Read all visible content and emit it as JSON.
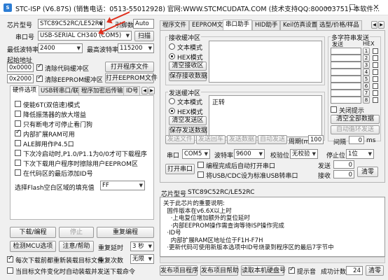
{
  "window": {
    "title": "STC-ISP (V6.87S) (销售电话：0513-55012928) 官网:WWW.STCMCUDATA.COM  (技术支持QQ:800003751) 本软件...",
    "min_icon": "minimize-icon",
    "max_icon": "maximize-icon",
    "close_icon": "close-icon",
    "min": "—",
    "max": "☐",
    "close": "✕"
  },
  "left": {
    "chip_label": "芯片型号",
    "chip_value": "STC89C52RC/LE52RC",
    "pin_label": "引脚数",
    "pin_value": "Auto",
    "port_label": "串口号",
    "port_value": "USB-SERIAL CH340 (COM5)",
    "scan_button": "扫描",
    "min_baud_label": "最低波特率",
    "min_baud_value": "2400",
    "max_baud_label": "最高波特率",
    "max_baud_value": "115200",
    "start_addr_label": "起始地址",
    "addr1": "0x0000",
    "clear_code_label": "清除代码缓冲区",
    "open_prog_button": "打开程序文件",
    "addr2": "0x2000",
    "clear_eeprom_label": "清除EEPROM缓冲区",
    "open_eeprom_button": "打开EEPROM文件",
    "tabs": [
      "硬件选项",
      "USB转串口/联机",
      "程序加密后传输",
      "ID号"
    ],
    "tab_nav": [
      "◀",
      "▶"
    ],
    "options": [
      {
        "label": "使能6T(双倍速)模式",
        "checked": false
      },
      {
        "label": "降低振荡器的放大增益",
        "checked": false
      },
      {
        "label": "只有断电才可停止看门狗",
        "checked": false
      },
      {
        "label": "内部扩展RAM可用",
        "checked": true
      },
      {
        "label": "ALE脚用作P4.5口",
        "checked": false
      },
      {
        "label": "下次冷启动时,P1.0/P1.1为0/0才可下载程序",
        "checked": false
      },
      {
        "label": "下次下载用户程序时擦除用户EEPROM区",
        "checked": false
      },
      {
        "label": "在代码区的最后添加ID号",
        "checked": false
      }
    ],
    "flash_fill_label": "选择Flash空白区域的填充值",
    "flash_fill_value": "FF",
    "download_button": "下载/编程",
    "stop_button": "停止",
    "reprogram_button": "重复编程",
    "detect_button": "检测MCU选项",
    "help_button": "注意/帮助",
    "repeat_delay_label": "重复延时",
    "repeat_delay_value": "3 秒",
    "repeat_count_label": "重复次数",
    "repeat_count_value": "无限",
    "reload_check_label": "每次下载前都重新装载目标文件",
    "reload_checked": true,
    "auto_load_label": "当目标文件变化时自动装载并发送下载命令",
    "auto_load_checked": false
  },
  "right": {
    "tabs": [
      "程序文件",
      "EEPROM文件",
      "串口助手",
      "HID助手",
      "Keil仿真设置",
      "选型/价格/样品"
    ],
    "recv": {
      "title": "接收缓冲区",
      "text_mode": "文本模式",
      "hex_mode": "HEX模式",
      "clear": "清空接收区",
      "save": "保存接收数据"
    },
    "send": {
      "title": "发送缓冲区",
      "text_mode": "文本模式",
      "hex_mode": "HEX模式",
      "content": "正转",
      "clear": "清空发送区",
      "save": "保存发送数据"
    },
    "send_btns": [
      "发送文件",
      "发送回车",
      "发送数据",
      "自动发送"
    ],
    "period_label": "周期(ms)",
    "period_value": "100",
    "port_label": "串口",
    "port_value": "COM5",
    "baud_label": "波特率",
    "baud_value": "9600",
    "parity_label": "校验位",
    "parity_value": "无校验",
    "stop_label": "停止位",
    "stop_value": "1位",
    "open_port": "打开串口",
    "auto_open_label": "编程完成后自动打开串口",
    "usb_cdc_label": "将USB/CDC设为标准USB转串口",
    "send_count_label": "发送",
    "send_count": "0",
    "recv_count_label": "接收",
    "recv_count": "0",
    "clear_count": "清零",
    "multi": {
      "title": "多字符串发送",
      "col_send": "发送",
      "col_hex": "HEX",
      "rows": [
        "1",
        "2",
        "3",
        "4",
        "5",
        "6",
        "7",
        "8"
      ],
      "close_tip": "关闭提示",
      "clear_all": "清空全部数据",
      "auto_loop": "自动循环发送",
      "interval_label": "间隔",
      "interval_value": "0",
      "interval_unit": "ms"
    }
  },
  "log": {
    "chip_label": "芯片型号",
    "chip_value": "STC89C52RC/LE52RC",
    "lines": [
      "关于此芯片的重要说明:",
      "  固件版本在v6.6X以上时",
      "    ·上电复位增加额外的复位延时",
      "    ·内部EEPROM操作需查询等待ISP操作完成",
      "  ·ID号",
      "    内部扩展RAM区地址位于F1H-F7H",
      "  ·更新代码可使用新版本选项中ID号烧录到程序区的最后7字节中"
    ]
  },
  "bottom": {
    "publish_prog": "发布项目程序",
    "publish_help": "发布项目帮助",
    "read_disk_id": "读取本机硬盘号",
    "tip_label": "提示音",
    "success_label": "成功计数",
    "success_count": "24",
    "clear": "清零"
  }
}
